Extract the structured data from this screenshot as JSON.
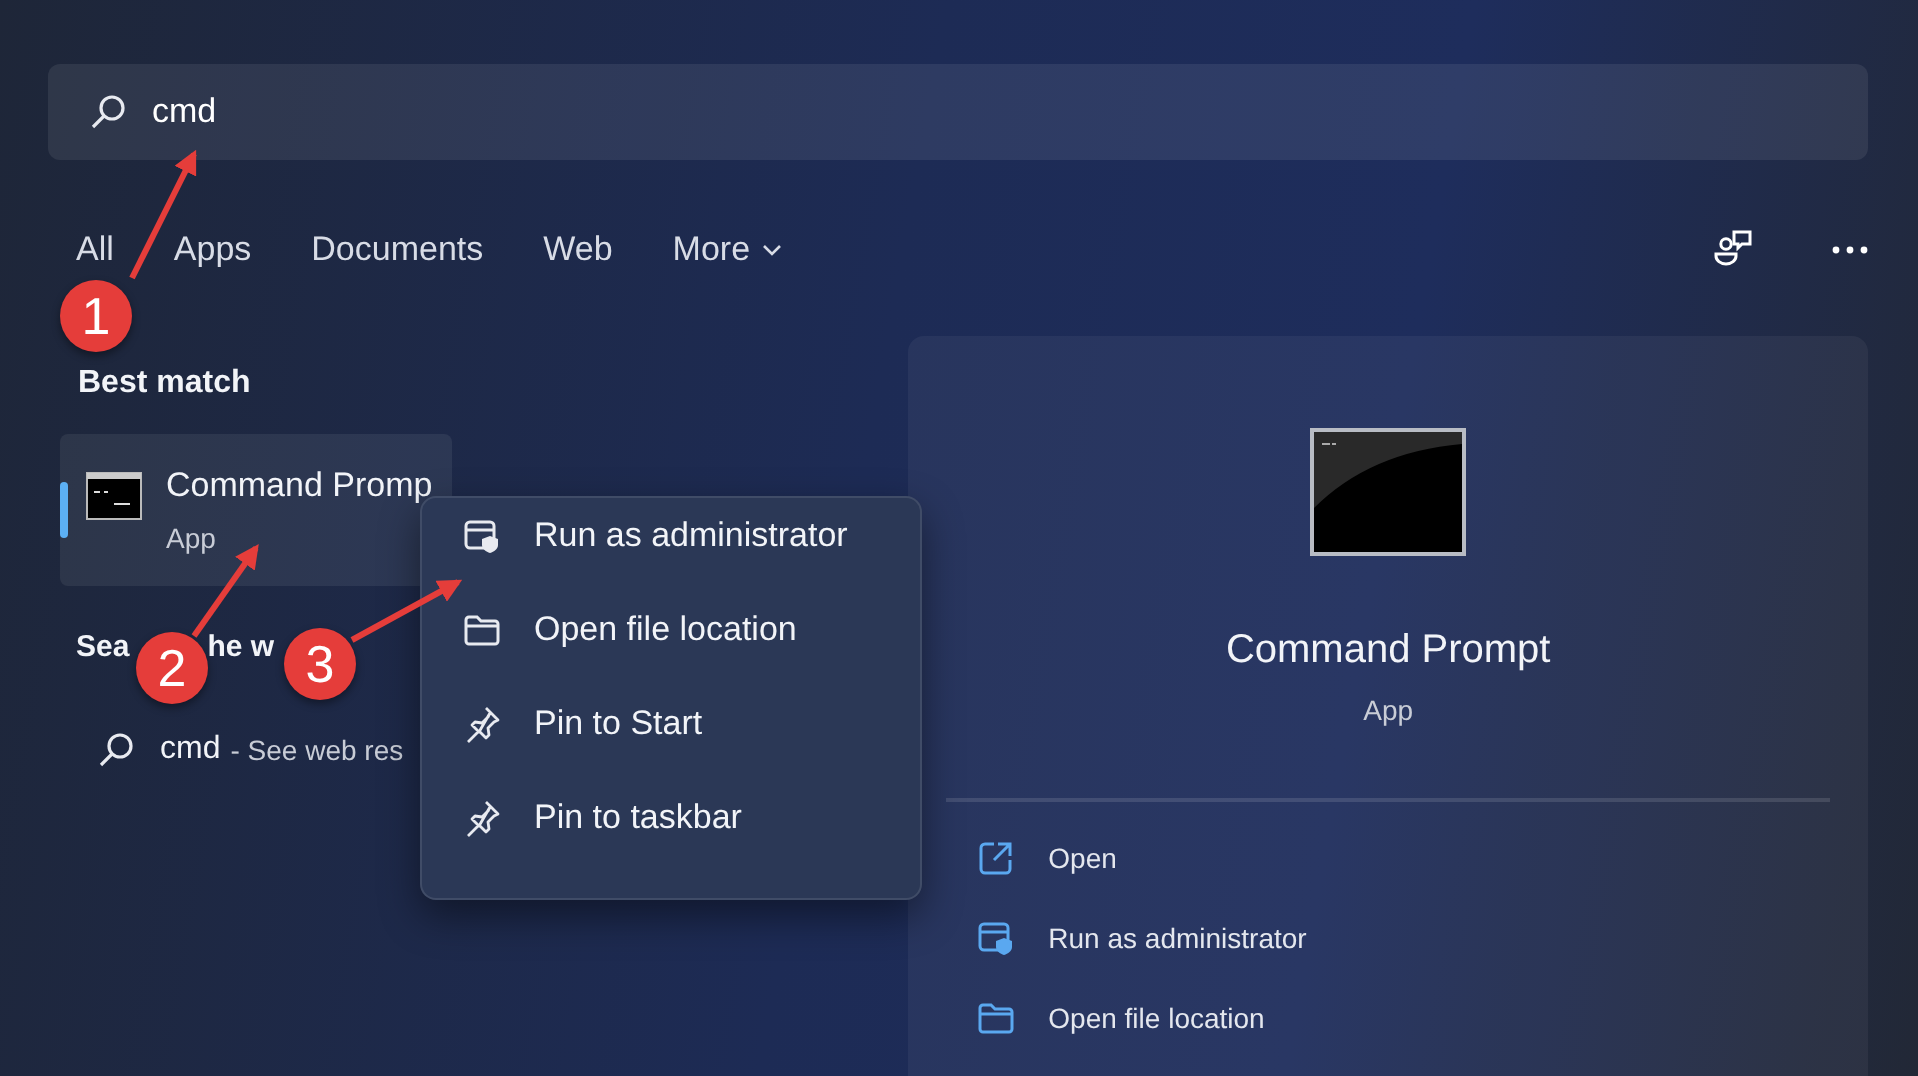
{
  "search": {
    "value": "cmd"
  },
  "filters": [
    {
      "label": "All",
      "caret": false
    },
    {
      "label": "Apps",
      "caret": false
    },
    {
      "label": "Documents",
      "caret": false
    },
    {
      "label": "Web",
      "caret": false
    },
    {
      "label": "More",
      "caret": true
    }
  ],
  "best_match": {
    "heading": "Best match",
    "title": "Command Promp",
    "subtitle": "App",
    "selected": true
  },
  "web_section": {
    "heading_parts": [
      "Sea",
      "he w"
    ],
    "query": "cmd",
    "suffix": "- See web res"
  },
  "context_menu": [
    {
      "label": "Run as administrator",
      "kind": "admin"
    },
    {
      "label": "Open file location",
      "kind": "folder"
    },
    {
      "label": "Pin to Start",
      "kind": "pin"
    },
    {
      "label": "Pin to taskbar",
      "kind": "pin"
    }
  ],
  "preview": {
    "title": "Command Prompt",
    "subtitle": "App",
    "actions": [
      {
        "label": "Open",
        "kind": "open"
      },
      {
        "label": "Run as administrator",
        "kind": "admin"
      },
      {
        "label": "Open file location",
        "kind": "folder"
      }
    ]
  },
  "annotations": [
    {
      "number": "1"
    },
    {
      "number": "2"
    },
    {
      "number": "3"
    }
  ]
}
